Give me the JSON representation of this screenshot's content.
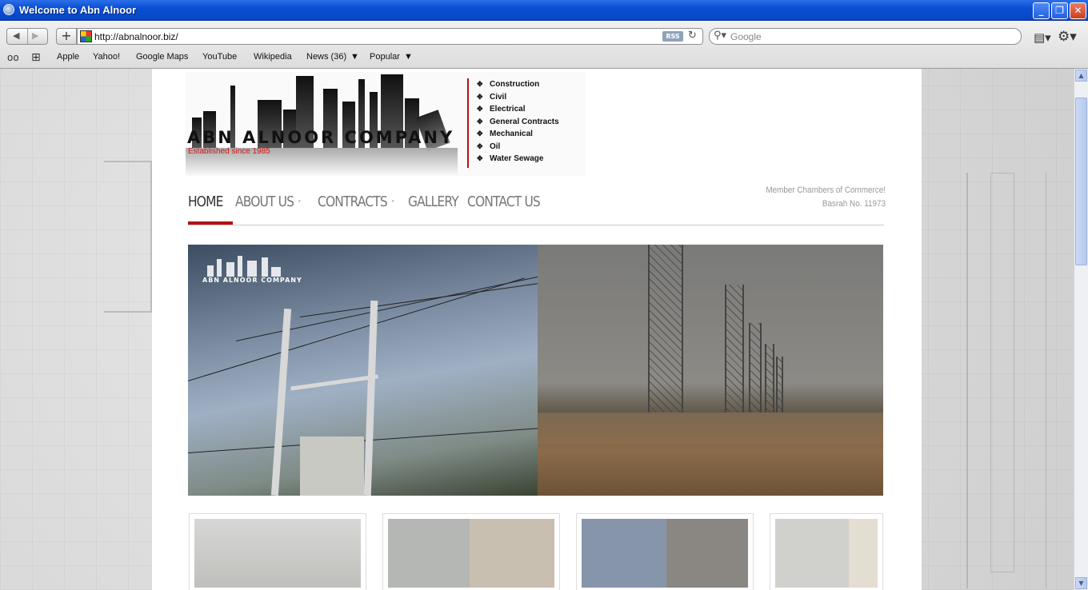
{
  "window": {
    "title": "Welcome to Abn Alnoor"
  },
  "browser": {
    "url": "http://abnalnoor.biz/",
    "rss_label": "RSS",
    "search_placeholder": "Google",
    "bookmarks": [
      "Apple",
      "Yahoo!",
      "Google Maps",
      "YouTube",
      "Wikipedia",
      "News (36)",
      "Popular"
    ]
  },
  "logo": {
    "title": "ABN ALNOOR COMPANY",
    "subtitle": "Established since 1985",
    "services": [
      "Construction",
      "Civil",
      "Electrical",
      "General Contracts",
      "Mechanical",
      "Oil",
      "Water Sewage"
    ]
  },
  "nav": {
    "items": [
      {
        "label": "HOME"
      },
      {
        "label": "ABOUT US"
      },
      {
        "label": "CONTRACTS"
      },
      {
        "label": "GALLERY"
      },
      {
        "label": "CONTACT US"
      }
    ]
  },
  "member": {
    "line1": "Member Chambers of Commerce!",
    "line2": "Basrah No. 11973"
  },
  "slider": {
    "logo_text": "ABN ALNOOR COMPANY"
  },
  "colors": {
    "accent": "#b31212",
    "titlebar": "#0a4fd3"
  }
}
